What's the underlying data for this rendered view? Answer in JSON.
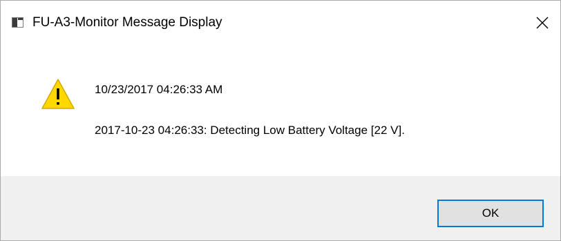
{
  "window": {
    "title": "FU-A3-Monitor Message Display",
    "app_icon": "window-app-icon",
    "close_icon": "close-icon"
  },
  "message": {
    "icon": "warning-icon",
    "line1": "10/23/2017 04:26:33 AM",
    "line2": "2017-10-23 04:26:33: Detecting Low Battery Voltage [22 V]."
  },
  "footer": {
    "ok_label": "OK"
  },
  "colors": {
    "warning_fill": "#ffd800",
    "warning_border": "#d4a900",
    "button_focus_border": "#0078d7",
    "footer_background": "#f0f0f0"
  }
}
